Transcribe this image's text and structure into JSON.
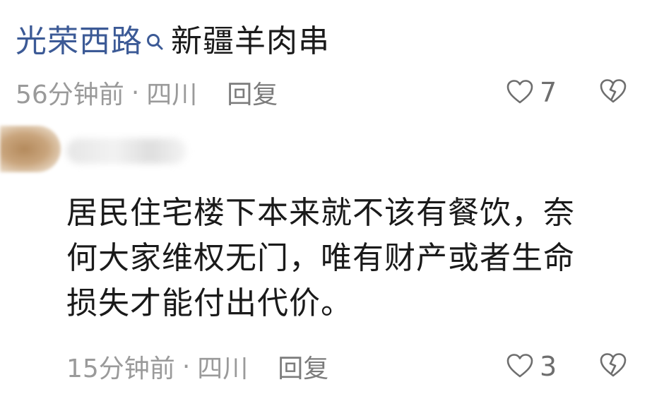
{
  "comment1": {
    "link_text": "光荣西路",
    "text": "新疆羊肉串",
    "time": "56分钟前",
    "separator": "·",
    "location": "四川",
    "reply_label": "回复",
    "like_count": "7"
  },
  "comment2": {
    "lines": [
      "居民住宅楼下本来就不该有餐饮，奈",
      "何大家维权无门，唯有财产或者生命",
      "损失才能付出代价。"
    ],
    "time": "15分钟前",
    "separator": "·",
    "location": "四川",
    "reply_label": "回复",
    "like_count": "3"
  },
  "colors": {
    "link": "#3c5a96",
    "meta_text": "#9a9a9a",
    "body_text": "#1a1a1a"
  },
  "icons": {
    "search": "search-icon",
    "like": "heart-outline-icon",
    "dislike": "broken-heart-icon"
  }
}
